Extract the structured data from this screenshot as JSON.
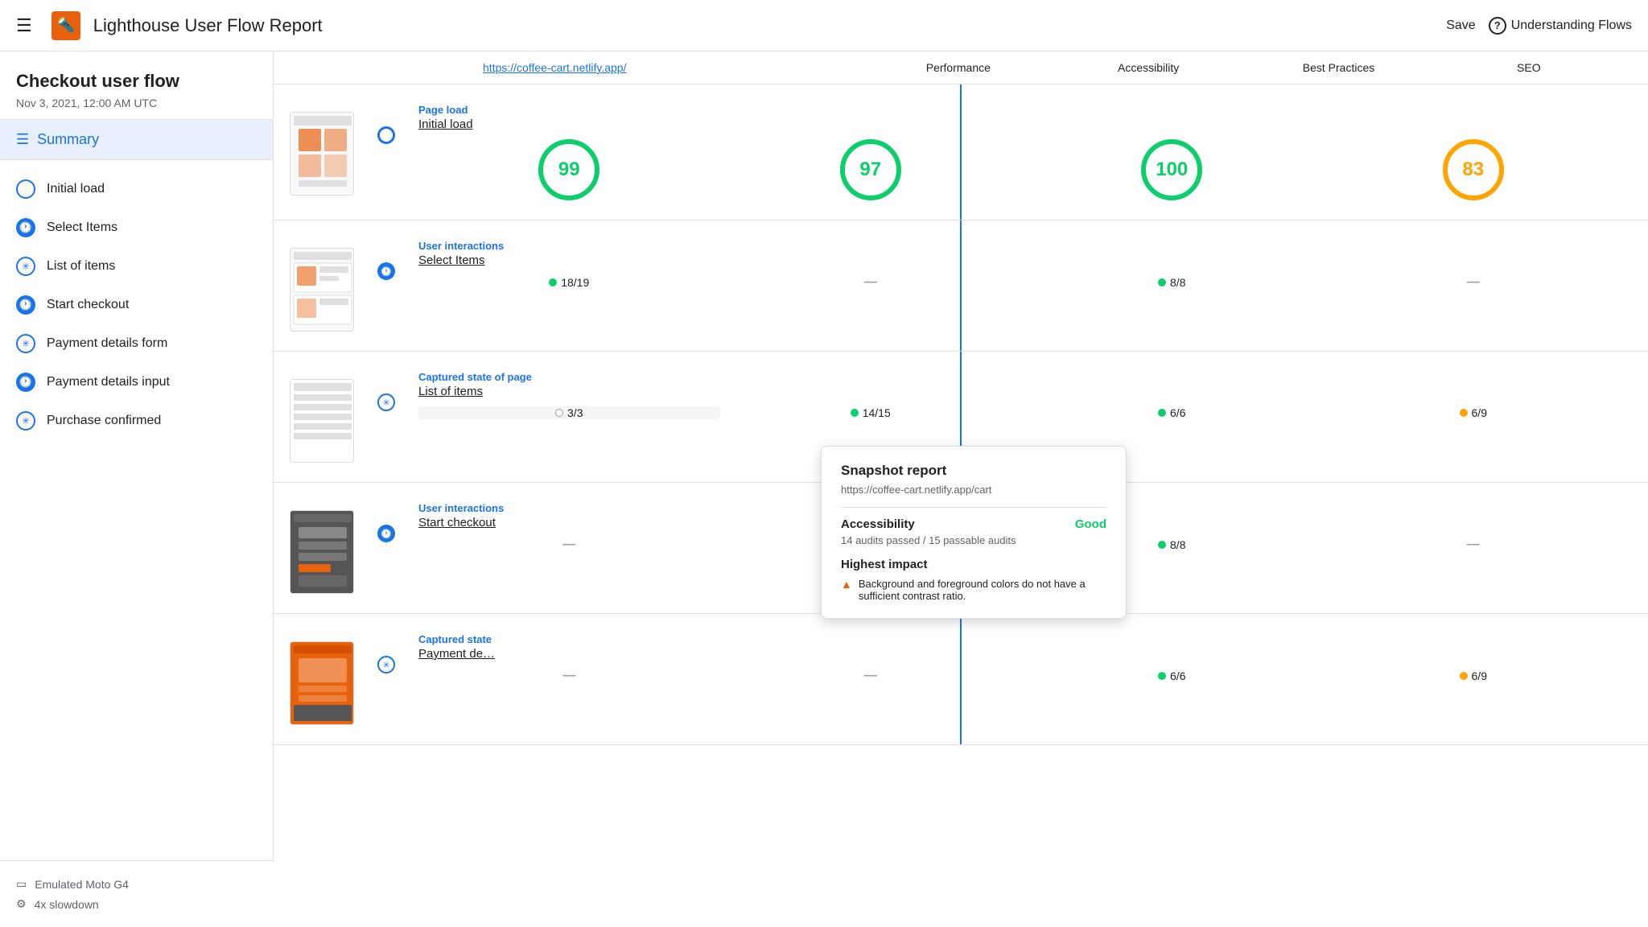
{
  "topbar": {
    "hamburger_label": "☰",
    "logo_text": "🔦",
    "title": "Lighthouse User Flow Report",
    "save_label": "Save",
    "understanding_label": "Understanding Flows",
    "help_icon": "?"
  },
  "sidebar": {
    "flow_title": "Checkout user flow",
    "date": "Nov 3, 2021, 12:00 AM UTC",
    "summary_label": "Summary",
    "steps": [
      {
        "id": "initial-load",
        "type": "load",
        "label": "Initial load"
      },
      {
        "id": "select-items",
        "type": "clock",
        "label": "Select Items"
      },
      {
        "id": "list-of-items",
        "type": "snap",
        "label": "List of items"
      },
      {
        "id": "start-checkout",
        "type": "clock",
        "label": "Start checkout"
      },
      {
        "id": "payment-details-form",
        "type": "snap",
        "label": "Payment details form"
      },
      {
        "id": "payment-details-input",
        "type": "clock",
        "label": "Payment details input"
      },
      {
        "id": "purchase-confirmed",
        "type": "snap",
        "label": "Purchase confirmed"
      }
    ],
    "footer": [
      {
        "id": "device",
        "icon": "□",
        "label": "Emulated Moto G4"
      },
      {
        "id": "slowdown",
        "icon": "⚙",
        "label": "4x slowdown"
      }
    ]
  },
  "main": {
    "url": "https://coffee-cart.netlify.app/",
    "columns": [
      "Performance",
      "Accessibility",
      "Best Practices",
      "SEO"
    ],
    "rows": [
      {
        "type": "Page load",
        "name": "Initial load",
        "dot_type": "load",
        "scores": [
          {
            "kind": "circle",
            "value": 99,
            "color": "g"
          },
          {
            "kind": "circle",
            "value": 97,
            "color": "g"
          },
          {
            "kind": "circle",
            "value": 100,
            "color": "g"
          },
          {
            "kind": "circle",
            "value": 83,
            "color": "o"
          }
        ]
      },
      {
        "type": "User interactions",
        "name": "Select Items",
        "dot_type": "clock",
        "scores": [
          {
            "kind": "pill",
            "dot": "g",
            "value": "18/19"
          },
          {
            "kind": "dash"
          },
          {
            "kind": "pill",
            "dot": "g",
            "value": "8/8"
          },
          {
            "kind": "dash"
          }
        ]
      },
      {
        "type": "Captured state of page",
        "name": "List of items",
        "dot_type": "snap",
        "highlight_col": 0,
        "scores": [
          {
            "kind": "pill",
            "dot": "gray",
            "value": "3/3"
          },
          {
            "kind": "pill",
            "dot": "g",
            "value": "14/15"
          },
          {
            "kind": "pill",
            "dot": "g",
            "value": "6/6"
          },
          {
            "kind": "pill",
            "dot": "o",
            "value": "6/9"
          }
        ]
      },
      {
        "type": "User interactions",
        "name": "Start checkout",
        "dot_type": "clock",
        "scores": [
          {
            "kind": "dash"
          },
          {
            "kind": "dash"
          },
          {
            "kind": "pill",
            "dot": "g",
            "value": "8/8"
          },
          {
            "kind": "dash"
          }
        ]
      },
      {
        "type": "Captured state",
        "name": "Payment de…",
        "dot_type": "snap",
        "scores": [
          {
            "kind": "dash"
          },
          {
            "kind": "dash"
          },
          {
            "kind": "pill",
            "dot": "g",
            "value": "6/6"
          },
          {
            "kind": "pill",
            "dot": "o",
            "value": "6/9"
          }
        ]
      }
    ]
  },
  "tooltip": {
    "title": "Snapshot report",
    "url": "https://coffee-cart.netlify.app/cart",
    "section1_title": "Accessibility",
    "section1_status": "Good",
    "section1_desc": "14 audits passed / 15 passable audits",
    "section2_title": "Highest impact",
    "impact_icon": "▲",
    "impact_text": "Background and foreground colors do not have a sufficient contrast ratio."
  }
}
